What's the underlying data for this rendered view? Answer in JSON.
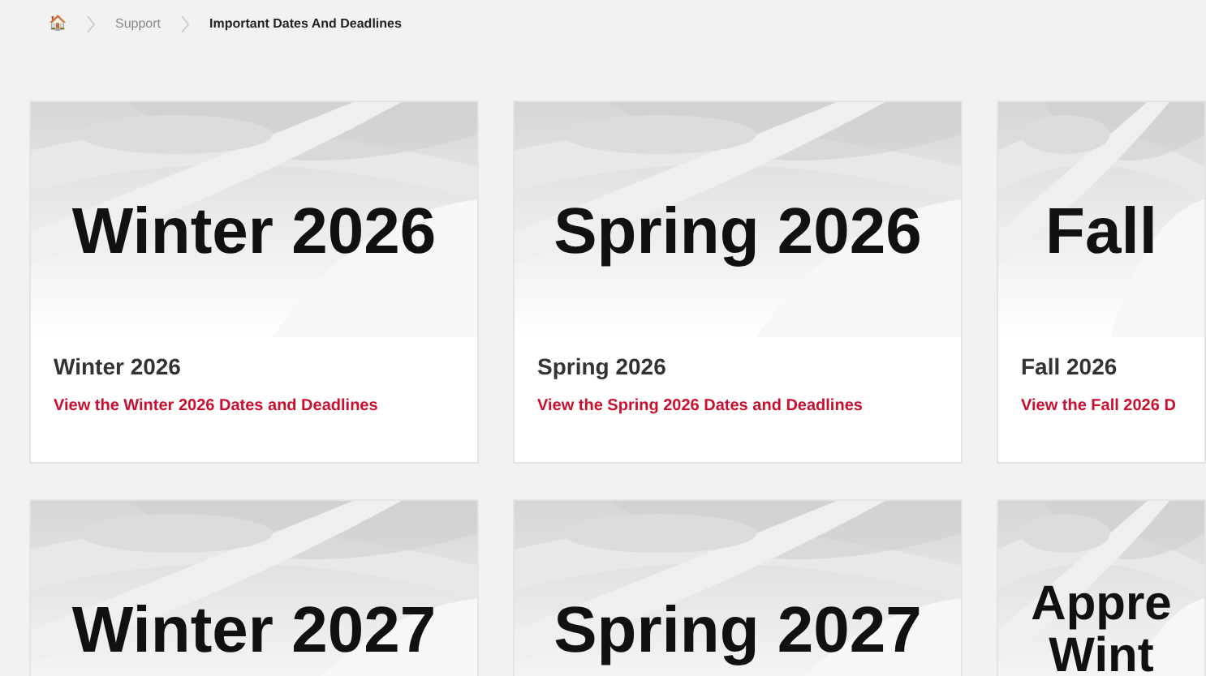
{
  "breadcrumb": {
    "home_icon": "🏠",
    "items": [
      {
        "label": "Support",
        "current": false
      },
      {
        "label": "Important Dates And Deadlines",
        "current": true
      }
    ]
  },
  "cards": [
    {
      "banner": [
        "Winter 2026"
      ],
      "title": "Winter 2026",
      "link": "View the Winter 2026 Dates and Deadlines"
    },
    {
      "banner": [
        "Spring 2026"
      ],
      "title": "Spring 2026",
      "link": "View the Spring 2026 Dates and Deadlines"
    },
    {
      "banner": [
        "Fall"
      ],
      "title": "Fall 2026",
      "link": "View the Fall 2026 D"
    },
    {
      "banner": [
        "Winter 2027"
      ]
    },
    {
      "banner": [
        "Spring 2027"
      ]
    },
    {
      "banner": [
        "Appre",
        "Wint"
      ]
    }
  ]
}
